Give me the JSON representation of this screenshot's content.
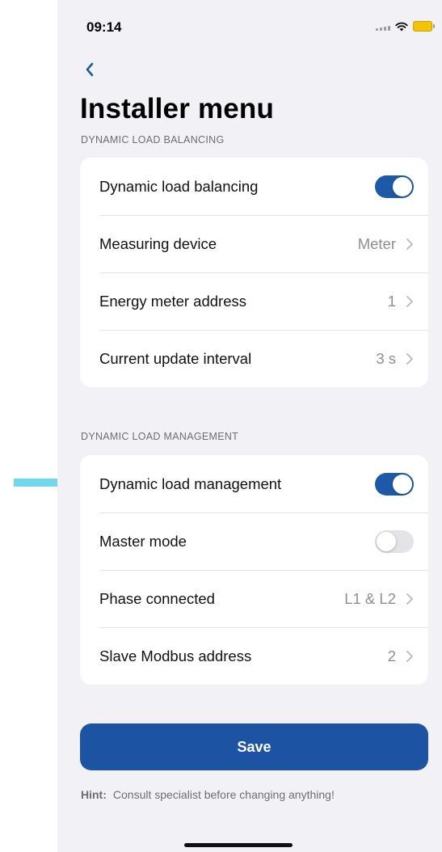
{
  "status_bar": {
    "time": "09:14",
    "icons": [
      "cellular-signal-icon",
      "wifi-icon",
      "battery-icon"
    ],
    "battery_color": "#f5c400"
  },
  "nav": {
    "back_icon": "chevron-left-icon"
  },
  "page": {
    "title": "Installer menu"
  },
  "balancing": {
    "section_label": "DYNAMIC LOAD BALANCING",
    "rows": [
      {
        "label": "Dynamic load balancing",
        "type": "toggle",
        "on": true
      },
      {
        "label": "Measuring device",
        "type": "value",
        "value": "Meter"
      },
      {
        "label": "Energy meter address",
        "type": "value",
        "value": "1"
      },
      {
        "label": "Current update interval",
        "type": "value",
        "value": "3 s"
      }
    ]
  },
  "management": {
    "section_label": "DYNAMIC LOAD MANAGEMENT",
    "rows": [
      {
        "label": "Dynamic load management",
        "type": "toggle",
        "on": true
      },
      {
        "label": "Master mode",
        "type": "toggle",
        "on": false
      },
      {
        "label": "Phase connected",
        "type": "value",
        "value": "L1 & L2"
      },
      {
        "label": "Slave Modbus address",
        "type": "value",
        "value": "2"
      }
    ]
  },
  "actions": {
    "save_label": "Save"
  },
  "hint": {
    "prefix": "Hint:",
    "text": "Consult specialist before changing anything!"
  },
  "annotation": {
    "arrow_color": "#6fd8ec"
  },
  "colors": {
    "accent": "#1c5aa8",
    "save_button": "#1c53a3",
    "background": "#f2f2f6"
  }
}
